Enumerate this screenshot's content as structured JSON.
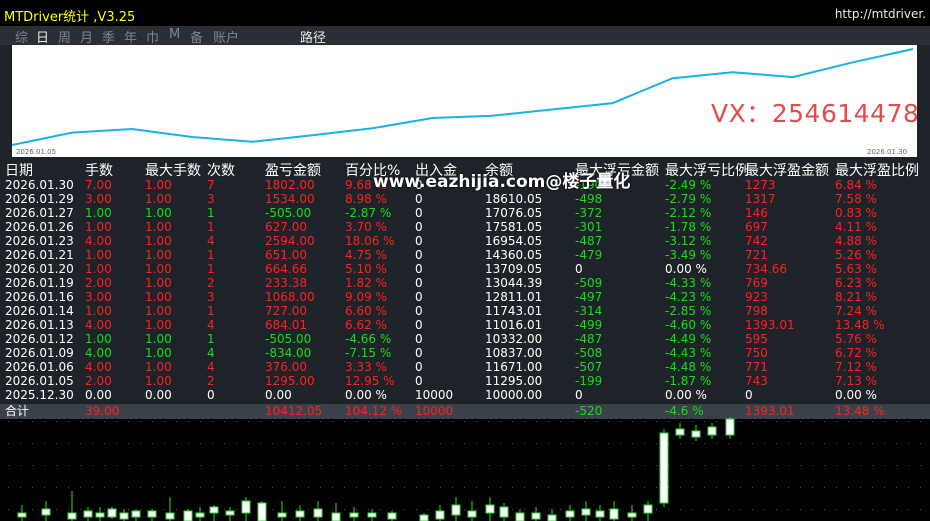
{
  "window": {
    "title": "MTDriver统计 ,V3.25",
    "url": "http://mtdriver."
  },
  "tabs": [
    {
      "label": "综",
      "active": false
    },
    {
      "label": "日",
      "active": true
    },
    {
      "label": "周",
      "active": false
    },
    {
      "label": "月",
      "active": false
    },
    {
      "label": "季",
      "active": false
    },
    {
      "label": "年",
      "active": false
    },
    {
      "label": "巾",
      "active": false
    },
    {
      "label": "M",
      "active": false
    },
    {
      "label": "备",
      "active": false
    },
    {
      "label": "账户",
      "active": false
    },
    {
      "label": "路径",
      "active": false
    }
  ],
  "equity_chart": {
    "start_label": "2026.01.05",
    "end_label": "2026.01.30",
    "line_color": "#1ab0e8",
    "values": [
      10000,
      11295,
      11671,
      10837,
      10332,
      11016,
      11743,
      12811,
      13044,
      13709,
      14360,
      16954,
      17581,
      17076,
      18610,
      20000
    ]
  },
  "watermarks": {
    "vx": "VX：254614478",
    "site": "www.eazhijia.com@楼子量化"
  },
  "colors": {
    "red": "#ff2020",
    "green": "#10e010",
    "white": "#ffffff",
    "header": "#ffffff"
  },
  "table": {
    "headers": [
      "日期",
      "手数",
      "最大手数",
      "次数",
      "盈亏金额",
      "百分比%",
      "出入金",
      "余额",
      "最大浮亏金额",
      "最大浮亏比例",
      "最大浮盈金额",
      "最大浮盈比例"
    ],
    "rows": [
      {
        "date": "2026.01.30",
        "lots": "7.00",
        "max_lots": "1.00",
        "count": "7",
        "pnl": "1802.00",
        "pct": "9.68 %",
        "cash": "0",
        "balance": "",
        "max_dd": "-190",
        "max_dd_pct": "-2.49 %",
        "max_up": "1273",
        "max_up_pct": "6.84 %",
        "color": "red"
      },
      {
        "date": "2026.01.29",
        "lots": "3.00",
        "max_lots": "1.00",
        "count": "3",
        "pnl": "1534.00",
        "pct": "8.98 %",
        "cash": "0",
        "balance": "18610.05",
        "max_dd": "-498",
        "max_dd_pct": "-2.79 %",
        "max_up": "1317",
        "max_up_pct": "7.58 %",
        "color": "red"
      },
      {
        "date": "2026.01.27",
        "lots": "1.00",
        "max_lots": "1.00",
        "count": "1",
        "pnl": "-505.00",
        "pct": "-2.87 %",
        "cash": "0",
        "balance": "17076.05",
        "max_dd": "-372",
        "max_dd_pct": "-2.12 %",
        "max_up": "146",
        "max_up_pct": "0.83 %",
        "color": "green"
      },
      {
        "date": "2026.01.26",
        "lots": "1.00",
        "max_lots": "1.00",
        "count": "1",
        "pnl": "627.00",
        "pct": "3.70 %",
        "cash": "0",
        "balance": "17581.05",
        "max_dd": "-301",
        "max_dd_pct": "-1.78 %",
        "max_up": "697",
        "max_up_pct": "4.11 %",
        "color": "red"
      },
      {
        "date": "2026.01.23",
        "lots": "4.00",
        "max_lots": "1.00",
        "count": "4",
        "pnl": "2594.00",
        "pct": "18.06 %",
        "cash": "0",
        "balance": "16954.05",
        "max_dd": "-487",
        "max_dd_pct": "-3.12 %",
        "max_up": "742",
        "max_up_pct": "4.88 %",
        "color": "red"
      },
      {
        "date": "2026.01.21",
        "lots": "1.00",
        "max_lots": "1.00",
        "count": "1",
        "pnl": "651.00",
        "pct": "4.75 %",
        "cash": "0",
        "balance": "14360.05",
        "max_dd": "-479",
        "max_dd_pct": "-3.49 %",
        "max_up": "721",
        "max_up_pct": "5.26 %",
        "color": "red"
      },
      {
        "date": "2026.01.20",
        "lots": "1.00",
        "max_lots": "1.00",
        "count": "1",
        "pnl": "664.66",
        "pct": "5.10 %",
        "cash": "0",
        "balance": "13709.05",
        "max_dd": "0",
        "max_dd_pct": "0.00 %",
        "max_up": "734.66",
        "max_up_pct": "5.63 %",
        "color": "red"
      },
      {
        "date": "2026.01.19",
        "lots": "2.00",
        "max_lots": "1.00",
        "count": "2",
        "pnl": "233.38",
        "pct": "1.82 %",
        "cash": "0",
        "balance": "13044.39",
        "max_dd": "-509",
        "max_dd_pct": "-4.33 %",
        "max_up": "769",
        "max_up_pct": "6.23 %",
        "color": "red"
      },
      {
        "date": "2026.01.16",
        "lots": "3.00",
        "max_lots": "1.00",
        "count": "3",
        "pnl": "1068.00",
        "pct": "9.09 %",
        "cash": "0",
        "balance": "12811.01",
        "max_dd": "-497",
        "max_dd_pct": "-4.23 %",
        "max_up": "923",
        "max_up_pct": "8.21 %",
        "color": "red"
      },
      {
        "date": "2026.01.14",
        "lots": "1.00",
        "max_lots": "1.00",
        "count": "1",
        "pnl": "727.00",
        "pct": "6.60 %",
        "cash": "0",
        "balance": "11743.01",
        "max_dd": "-314",
        "max_dd_pct": "-2.85 %",
        "max_up": "798",
        "max_up_pct": "7.24 %",
        "color": "red"
      },
      {
        "date": "2026.01.13",
        "lots": "4.00",
        "max_lots": "1.00",
        "count": "4",
        "pnl": "684.01",
        "pct": "6.62 %",
        "cash": "0",
        "balance": "11016.01",
        "max_dd": "-499",
        "max_dd_pct": "-4.60 %",
        "max_up": "1393.01",
        "max_up_pct": "13.48 %",
        "color": "red"
      },
      {
        "date": "2026.01.12",
        "lots": "1.00",
        "max_lots": "1.00",
        "count": "1",
        "pnl": "-505.00",
        "pct": "-4.66 %",
        "cash": "0",
        "balance": "10332.00",
        "max_dd": "-487",
        "max_dd_pct": "-4.49 %",
        "max_up": "595",
        "max_up_pct": "5.76 %",
        "color": "green"
      },
      {
        "date": "2026.01.09",
        "lots": "4.00",
        "max_lots": "1.00",
        "count": "4",
        "pnl": "-834.00",
        "pct": "-7.15 %",
        "cash": "0",
        "balance": "10837.00",
        "max_dd": "-508",
        "max_dd_pct": "-4.43 %",
        "max_up": "750",
        "max_up_pct": "6.72 %",
        "color": "green"
      },
      {
        "date": "2026.01.06",
        "lots": "4.00",
        "max_lots": "1.00",
        "count": "4",
        "pnl": "376.00",
        "pct": "3.33 %",
        "cash": "0",
        "balance": "11671.00",
        "max_dd": "-507",
        "max_dd_pct": "-4.48 %",
        "max_up": "771",
        "max_up_pct": "7.12 %",
        "color": "red"
      },
      {
        "date": "2026.01.05",
        "lots": "2.00",
        "max_lots": "1.00",
        "count": "2",
        "pnl": "1295.00",
        "pct": "12.95 %",
        "cash": "0",
        "balance": "11295.00",
        "max_dd": "-199",
        "max_dd_pct": "-1.87 %",
        "max_up": "743",
        "max_up_pct": "7.13 %",
        "color": "red"
      },
      {
        "date": "2025.12.30",
        "lots": "0.00",
        "max_lots": "0.00",
        "count": "0",
        "pnl": "0.00",
        "pct": "0.00 %",
        "cash": "10000",
        "balance": "10000.00",
        "max_dd": "0",
        "max_dd_pct": "0.00 %",
        "max_up": "0",
        "max_up_pct": "0.00 %",
        "color": "white"
      }
    ],
    "total": {
      "date": "合计",
      "lots": "39.00",
      "max_lots": "",
      "count": "",
      "pnl": "10412.05",
      "pct": "104.12 %",
      "cash": "10000",
      "balance": "",
      "max_dd": "-520",
      "max_dd_pct": "-4.6 %",
      "max_up": "1393.01",
      "max_up_pct": "13.48 %"
    }
  }
}
